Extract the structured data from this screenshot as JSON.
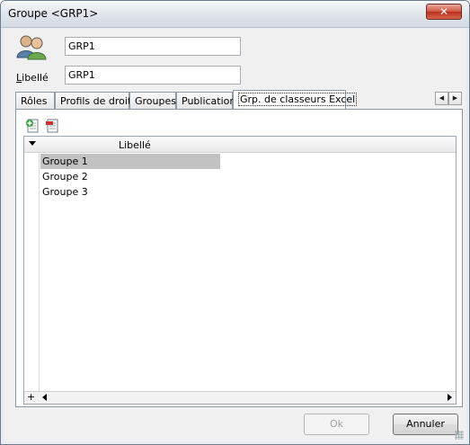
{
  "window": {
    "title": "Groupe <GRP1>",
    "close_label": "✕"
  },
  "form": {
    "code_value": "GRP1",
    "libelle_label_first": "L",
    "libelle_label_rest": "ibellé",
    "libelle_value": "GRP1"
  },
  "tabs": [
    {
      "label": "Rôles"
    },
    {
      "label": "Profils de droits"
    },
    {
      "label": "Groupes"
    },
    {
      "label": "Publication"
    },
    {
      "label": "Grp. de classeurs Excel"
    }
  ],
  "grid": {
    "column_header": "Libellé",
    "rows": [
      "Groupe 1",
      "Groupe 2",
      "Groupe 3"
    ],
    "add_row_symbol": "+"
  },
  "buttons": {
    "ok": "Ok",
    "cancel": "Annuler"
  }
}
